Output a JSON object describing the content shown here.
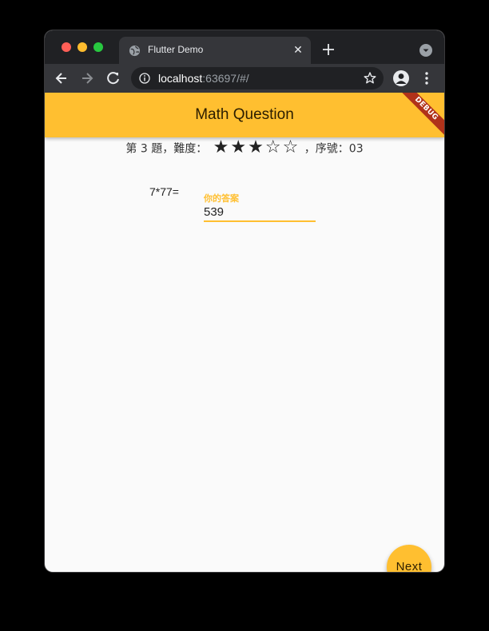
{
  "browser": {
    "tab_title": "Flutter Demo",
    "url_host": "localhost",
    "url_rest": ":63697/#/"
  },
  "app": {
    "title": "Math Question",
    "debug_banner": "DEBUG"
  },
  "info": {
    "prefix": "第 3 題，難度：",
    "difficulty": 3,
    "difficulty_max": 5,
    "suffix": "，序號：03"
  },
  "question": {
    "text": "7*77=",
    "answer_label": "你的答案",
    "answer_value": "539"
  },
  "fab": {
    "label": "Next"
  },
  "colors": {
    "accent": "#ffbf30",
    "debug": "#b0321a"
  }
}
